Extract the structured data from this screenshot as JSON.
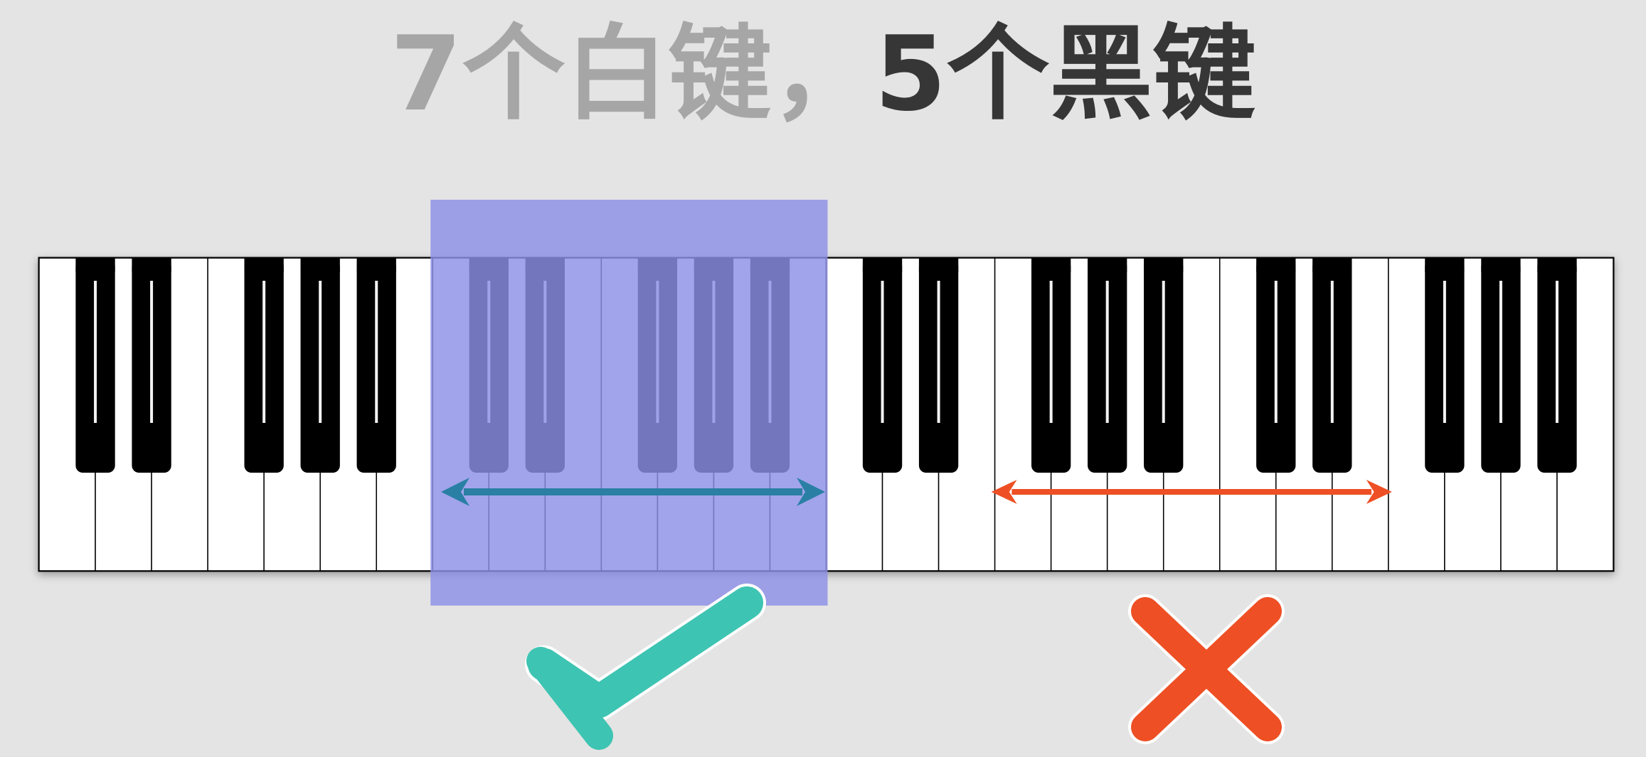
{
  "title": {
    "part1": "7个白键，",
    "part2": "5个黑键"
  },
  "keyboard": {
    "white_key_count": 28,
    "black_key_pattern": [
      2,
      3
    ],
    "octave_white_keys": 7,
    "octave_black_keys": 5,
    "highlighted_white_keys": {
      "start": 7,
      "end": 14
    },
    "wrong_span_white_keys": {
      "start": 17,
      "end": 24
    }
  },
  "colors": {
    "background": "#e4e4e4",
    "white_key": "#ffffff",
    "black_key": "#000000",
    "highlight": "#8c90e6",
    "correct_arrow": "#2a7fa5",
    "wrong_arrow": "#ee4f24",
    "check": "#3ec4b2",
    "cross": "#ee4f24"
  },
  "icons": {
    "correct": "checkmark-icon",
    "wrong": "cross-icon"
  }
}
